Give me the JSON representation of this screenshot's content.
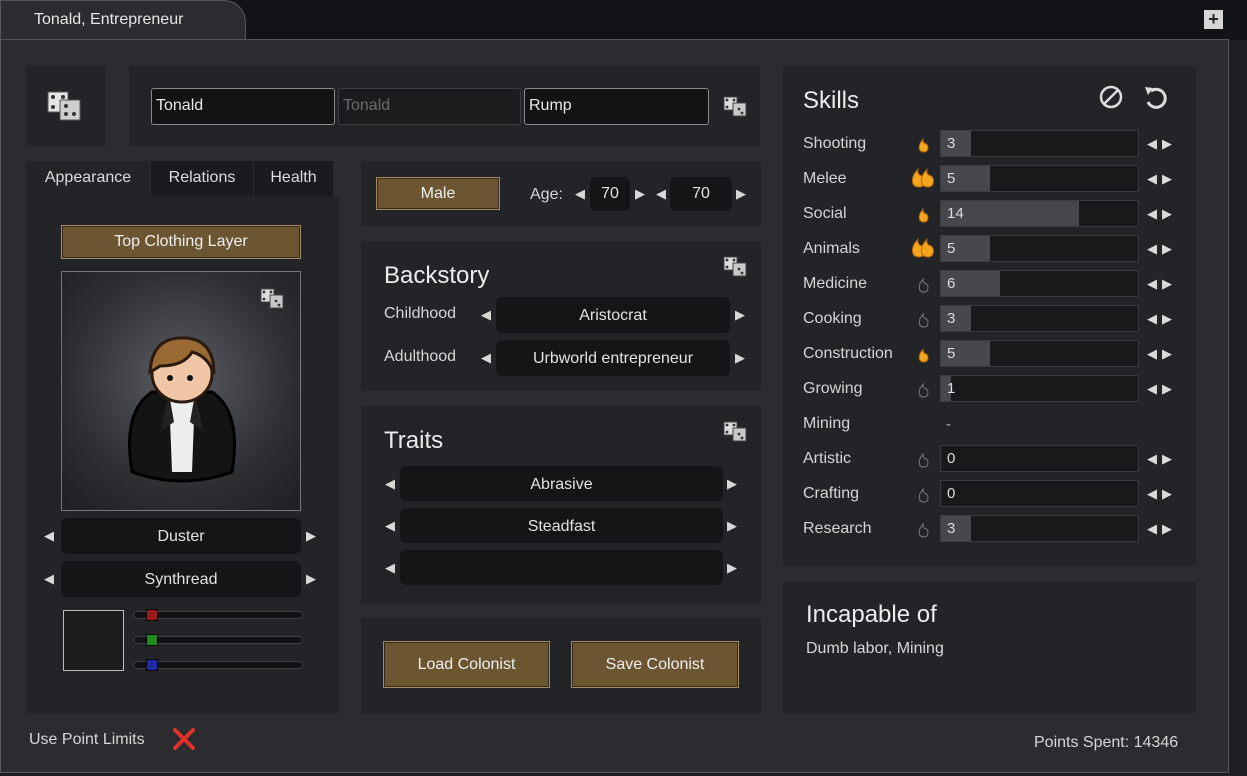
{
  "window": {
    "tab_title": "Tonald, Entrepreneur",
    "plus_label": "+"
  },
  "name": {
    "first": "Tonald",
    "nick": "Tonald",
    "last": "Rump"
  },
  "tabs": [
    {
      "label": "Appearance"
    },
    {
      "label": "Relations"
    },
    {
      "label": "Health"
    }
  ],
  "appearance": {
    "layer_button": "Top Clothing Layer",
    "apparel": "Duster",
    "material": "Synthread",
    "color_swatch": "#1b1c1c",
    "sliders": {
      "red": 0.07,
      "green": 0.07,
      "blue": 0.07
    }
  },
  "gender": {
    "label": "Male"
  },
  "age": {
    "label": "Age:",
    "biological": "70",
    "chronological": "70"
  },
  "backstory": {
    "title": "Backstory",
    "childhood_label": "Childhood",
    "childhood_value": "Aristocrat",
    "adulthood_label": "Adulthood",
    "adulthood_value": "Urbworld entrepreneur"
  },
  "traits": {
    "title": "Traits",
    "items": [
      "Abrasive",
      "Steadfast",
      ""
    ]
  },
  "buttons": {
    "load": "Load Colonist",
    "save": "Save Colonist"
  },
  "skills": {
    "title": "Skills",
    "max_level": 20,
    "items": [
      {
        "name": "Shooting",
        "value": "3",
        "passion": "minor"
      },
      {
        "name": "Melee",
        "value": "5",
        "passion": "major"
      },
      {
        "name": "Social",
        "value": "14",
        "passion": "minor"
      },
      {
        "name": "Animals",
        "value": "5",
        "passion": "major"
      },
      {
        "name": "Medicine",
        "value": "6",
        "passion": "none"
      },
      {
        "name": "Cooking",
        "value": "3",
        "passion": "none"
      },
      {
        "name": "Construction",
        "value": "5",
        "passion": "minor"
      },
      {
        "name": "Growing",
        "value": "1",
        "passion": "none"
      },
      {
        "name": "Mining",
        "value": "-",
        "passion": "disabled"
      },
      {
        "name": "Artistic",
        "value": "0",
        "passion": "none"
      },
      {
        "name": "Crafting",
        "value": "0",
        "passion": "none"
      },
      {
        "name": "Research",
        "value": "3",
        "passion": "none"
      }
    ]
  },
  "incapable": {
    "title": "Incapable of",
    "text": "Dumb labor, Mining"
  },
  "footer": {
    "point_limits_label": "Use Point Limits",
    "points_spent": "Points Spent: 14346"
  },
  "colors": {
    "passion": "#f2a51d",
    "brown_button": "#6c5632",
    "panel": "#232427"
  }
}
